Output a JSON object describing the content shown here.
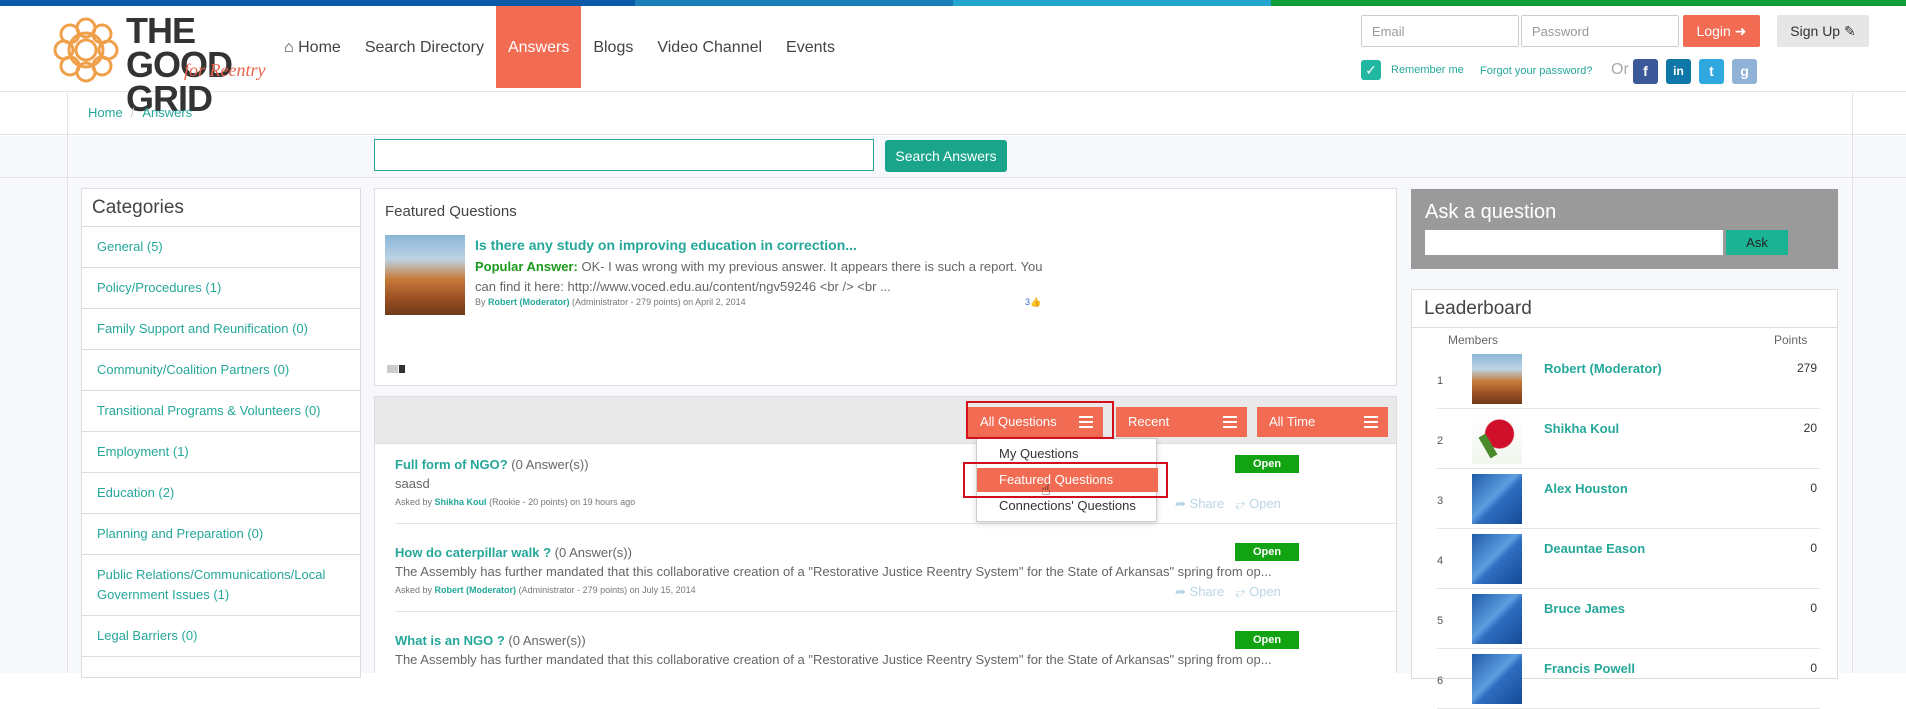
{
  "brand": {
    "logo_line1": "THE GOOD",
    "logo_line2": "GRID",
    "logo_tagline": "for Reentry",
    "accent": "#f26b53",
    "teal": "#25a79a",
    "stripe_colors": [
      "#0b5aa7",
      "#0b5aa7",
      "#1a7fb5",
      "#22a6d0",
      "#0d9e3a",
      "#0d9e3a"
    ]
  },
  "nav": {
    "items": [
      {
        "label": "Home",
        "icon": "home-icon"
      },
      {
        "label": "Search Directory"
      },
      {
        "label": "Answers",
        "active": true
      },
      {
        "label": "Blogs"
      },
      {
        "label": "Video Channel"
      },
      {
        "label": "Events"
      }
    ]
  },
  "login": {
    "email_placeholder": "Email",
    "password_placeholder": "Password",
    "login_label": "Login",
    "signup_label": "Sign Up",
    "remember_label": "Remember me",
    "forgot_label": "Forgot your password?",
    "or_label": "Or",
    "social": [
      "f",
      "in",
      "t",
      "g"
    ]
  },
  "breadcrumb": {
    "home": "Home",
    "current": "Answers"
  },
  "search": {
    "button_label": "Search Answers",
    "value": ""
  },
  "categories": {
    "title": "Categories",
    "items": [
      "General (5)",
      "Policy/Procedures (1)",
      "Family Support and Reunification (0)",
      "Community/Coalition Partners (0)",
      "Transitional Programs & Volunteers (0)",
      "Employment (1)",
      "Education (2)",
      "Planning and Preparation (0)",
      "Public Relations/Communications/Local Government Issues (1)",
      "Legal Barriers (0)"
    ]
  },
  "featured": {
    "title": "Featured Questions",
    "question": "Is there any study on improving education in correction...",
    "popular_label": "Popular Answer:",
    "answer": "OK- I was wrong with my previous answer. It appears there is such a report. You can find it here: http://www.voced.edu.au/content/ngv59246 <br /> <br ...",
    "by_prefix": "By",
    "author": "Robert (Moderator)",
    "author_meta": "(Administrator - 279 points)  on April 2, 2014",
    "votes": "3"
  },
  "filters": {
    "questions": "All Questions",
    "sort": "Recent",
    "time": "All Time",
    "dropdown": [
      "My Questions",
      "Featured Questions",
      "Connections' Questions"
    ]
  },
  "questions": [
    {
      "title": "Full form of NGO?",
      "count": "(0 Answer(s))",
      "desc": "saasd",
      "asked_by": "Asked by",
      "author": "Shikha Koul",
      "meta": "(Rookie - 20 points)  on 19 hours ago",
      "status": "Open",
      "share": "Share",
      "open": "Open"
    },
    {
      "title": "How do caterpillar walk ?",
      "count": "(0 Answer(s))",
      "desc": "The Assembly has further mandated that this collaborative creation of a \"Restorative Justice Reentry System\" for the State of Arkansas\" spring from op...",
      "asked_by": "Asked by",
      "author": "Robert (Moderator)",
      "meta": "(Administrator - 279 points)  on July 15, 2014",
      "status": "Open",
      "share": "Share",
      "open": "Open"
    },
    {
      "title": "What is an NGO ?",
      "count": "(0 Answer(s))",
      "desc": "The Assembly has further mandated that this collaborative creation of a \"Restorative Justice Reentry System\" for the State of Arkansas\" spring from op...",
      "status": "Open"
    }
  ],
  "ask": {
    "title": "Ask a question",
    "button": "Ask"
  },
  "leaderboard": {
    "title": "Leaderboard",
    "col_members": "Members",
    "col_points": "Points",
    "rows": [
      {
        "rank": "1",
        "name": "Robert (Moderator)",
        "points": "279",
        "avatar": "canyon"
      },
      {
        "rank": "2",
        "name": "Shikha Koul",
        "points": "20",
        "avatar": "rose"
      },
      {
        "rank": "3",
        "name": "Alex Houston",
        "points": "0",
        "avatar": "default"
      },
      {
        "rank": "4",
        "name": "Deauntae Eason",
        "points": "0",
        "avatar": "default"
      },
      {
        "rank": "5",
        "name": "Bruce James",
        "points": "0",
        "avatar": "default"
      },
      {
        "rank": "6",
        "name": "Francis Powell",
        "points": "0",
        "avatar": "default"
      }
    ]
  }
}
